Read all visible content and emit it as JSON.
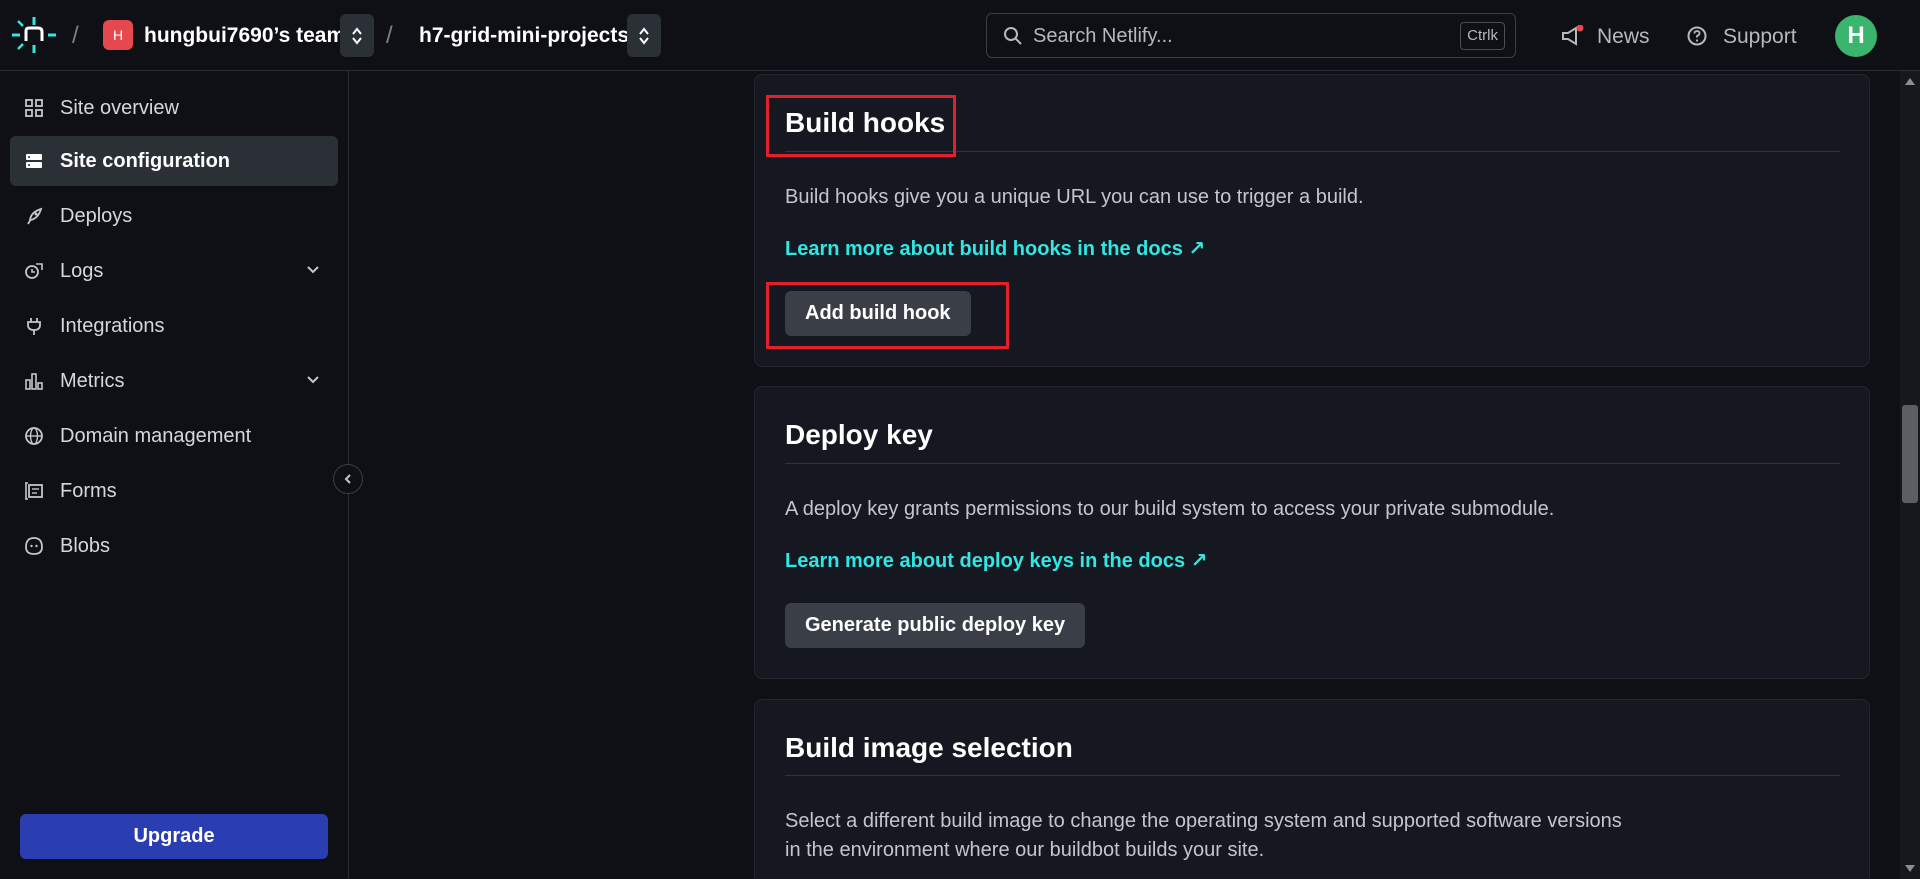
{
  "header": {
    "team_initial": "H",
    "team_name": "hungbui7690’s team",
    "site_name": "h7-grid-mini-projects",
    "search_placeholder": "Search Netlify...",
    "search_shortcut": "Ctrlk",
    "news_label": "News",
    "support_label": "Support",
    "user_initial": "H",
    "separator": "/"
  },
  "sidebar": {
    "items": [
      {
        "label": "Site overview",
        "icon": "grid-icon"
      },
      {
        "label": "Site configuration",
        "icon": "server-icon",
        "active": true
      },
      {
        "label": "Deploys",
        "icon": "rocket-icon"
      },
      {
        "label": "Logs",
        "icon": "logs-icon",
        "expandable": true
      },
      {
        "label": "Integrations",
        "icon": "plug-icon"
      },
      {
        "label": "Metrics",
        "icon": "bar-chart-icon",
        "expandable": true
      },
      {
        "label": "Domain management",
        "icon": "globe-icon"
      },
      {
        "label": "Forms",
        "icon": "form-icon"
      },
      {
        "label": "Blobs",
        "icon": "blob-icon"
      }
    ],
    "upgrade_label": "Upgrade"
  },
  "main": {
    "build_hooks": {
      "title": "Build hooks",
      "description": "Build hooks give you a unique URL you can use to trigger a build.",
      "link": "Learn more about build hooks in the docs ↗",
      "button": "Add build hook"
    },
    "deploy_key": {
      "title": "Deploy key",
      "description": "A deploy key grants permissions to our build system to access your private submodule.",
      "link": "Learn more about deploy keys in the docs ↗",
      "button": "Generate public deploy key"
    },
    "build_image": {
      "title": "Build image selection",
      "description_line1": "Select a different build image to change the operating system and supported software versions",
      "description_line2": "in the environment where our buildbot builds your site."
    }
  },
  "colors": {
    "background": "#0e1015",
    "card": "#151820",
    "link": "#32e6e2",
    "upgrade": "#2a3eb1",
    "highlight": "#e0202a",
    "avatar_user": "#3bb56d",
    "avatar_team": "#e5484d"
  }
}
